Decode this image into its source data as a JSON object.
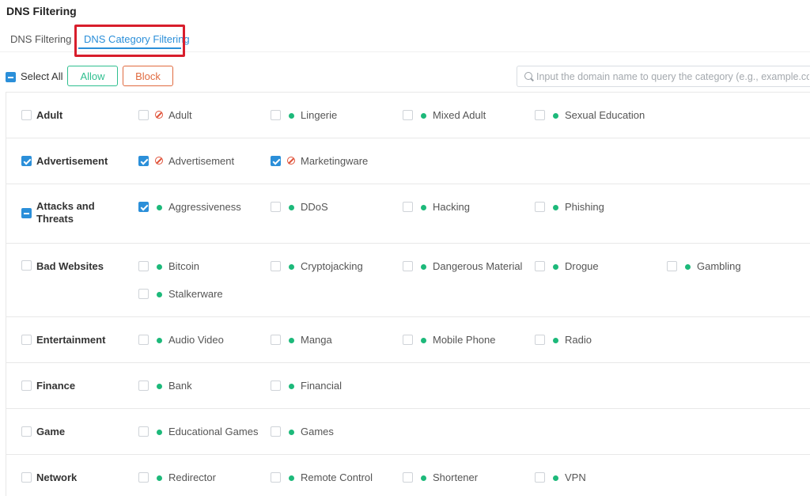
{
  "page": {
    "title": "DNS Filtering"
  },
  "tabs": [
    {
      "label": "DNS Filtering",
      "active": false
    },
    {
      "label": "DNS Category Filtering",
      "active": true
    }
  ],
  "toolbar": {
    "select_all_label": "Select All",
    "select_all_state": "indeterminate",
    "allow_label": "Allow",
    "block_label": "Block",
    "search_placeholder": "Input the domain name to query the category (e.g., example.com).",
    "search_value": ""
  },
  "colors": {
    "accent": "#2b8fd9",
    "allow": "#2fbf8f",
    "block": "#e06a3f",
    "status_allowed": "#1db97a",
    "status_blocked": "#e0533a",
    "highlight": "#d81e2c"
  },
  "categories": [
    {
      "name": "Adult",
      "state": "unchecked",
      "items": [
        {
          "label": "Adult",
          "checked": false,
          "status": "blocked"
        },
        {
          "label": "Lingerie",
          "checked": false,
          "status": "allowed"
        },
        {
          "label": "Mixed Adult",
          "checked": false,
          "status": "allowed"
        },
        {
          "label": "Sexual Education",
          "checked": false,
          "status": "allowed"
        }
      ]
    },
    {
      "name": "Advertisement",
      "state": "checked",
      "items": [
        {
          "label": "Advertisement",
          "checked": true,
          "status": "blocked"
        },
        {
          "label": "Marketingware",
          "checked": true,
          "status": "blocked"
        }
      ]
    },
    {
      "name": "Attacks and Threats",
      "name_line1": "Attacks and",
      "name_line2": "Threats",
      "state": "indeterminate",
      "items": [
        {
          "label": "Aggressiveness",
          "checked": true,
          "status": "allowed"
        },
        {
          "label": "DDoS",
          "checked": false,
          "status": "allowed"
        },
        {
          "label": "Hacking",
          "checked": false,
          "status": "allowed"
        },
        {
          "label": "Phishing",
          "checked": false,
          "status": "allowed"
        }
      ]
    },
    {
      "name": "Bad Websites",
      "state": "unchecked",
      "items": [
        {
          "label": "Bitcoin",
          "checked": false,
          "status": "allowed"
        },
        {
          "label": "Cryptojacking",
          "checked": false,
          "status": "allowed"
        },
        {
          "label": "Dangerous Material",
          "checked": false,
          "status": "allowed"
        },
        {
          "label": "Drogue",
          "checked": false,
          "status": "allowed"
        },
        {
          "label": "Gambling",
          "checked": false,
          "status": "allowed"
        },
        {
          "label": "Stalkerware",
          "checked": false,
          "status": "allowed"
        }
      ]
    },
    {
      "name": "Entertainment",
      "state": "unchecked",
      "items": [
        {
          "label": "Audio Video",
          "checked": false,
          "status": "allowed"
        },
        {
          "label": "Manga",
          "checked": false,
          "status": "allowed"
        },
        {
          "label": "Mobile Phone",
          "checked": false,
          "status": "allowed"
        },
        {
          "label": "Radio",
          "checked": false,
          "status": "allowed"
        }
      ]
    },
    {
      "name": "Finance",
      "state": "unchecked",
      "items": [
        {
          "label": "Bank",
          "checked": false,
          "status": "allowed"
        },
        {
          "label": "Financial",
          "checked": false,
          "status": "allowed"
        }
      ]
    },
    {
      "name": "Game",
      "state": "unchecked",
      "items": [
        {
          "label": "Educational Games",
          "checked": false,
          "status": "allowed"
        },
        {
          "label": "Games",
          "checked": false,
          "status": "allowed"
        }
      ]
    },
    {
      "name": "Network",
      "state": "unchecked",
      "items": [
        {
          "label": "Redirector",
          "checked": false,
          "status": "allowed"
        },
        {
          "label": "Remote Control",
          "checked": false,
          "status": "allowed"
        },
        {
          "label": "Shortener",
          "checked": false,
          "status": "allowed"
        },
        {
          "label": "VPN",
          "checked": false,
          "status": "allowed"
        }
      ]
    }
  ]
}
